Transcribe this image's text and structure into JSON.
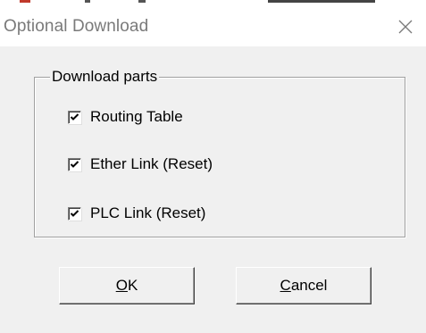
{
  "window": {
    "title": "Optional Download",
    "close_icon": "close-icon"
  },
  "group": {
    "legend": "Download parts",
    "items": [
      {
        "label": "Routing Table",
        "checked": true
      },
      {
        "label": "Ether Link (Reset)",
        "checked": true
      },
      {
        "label": "PLC Link (Reset)",
        "checked": true
      }
    ]
  },
  "buttons": {
    "ok": {
      "mnemonic": "O",
      "rest": "K"
    },
    "cancel": {
      "mnemonic": "C",
      "rest": "ancel"
    }
  },
  "colors": {
    "dialog_bg": "#f0f0f0",
    "titlebar_bg": "#ffffff",
    "title_text": "#7a7a7a"
  }
}
